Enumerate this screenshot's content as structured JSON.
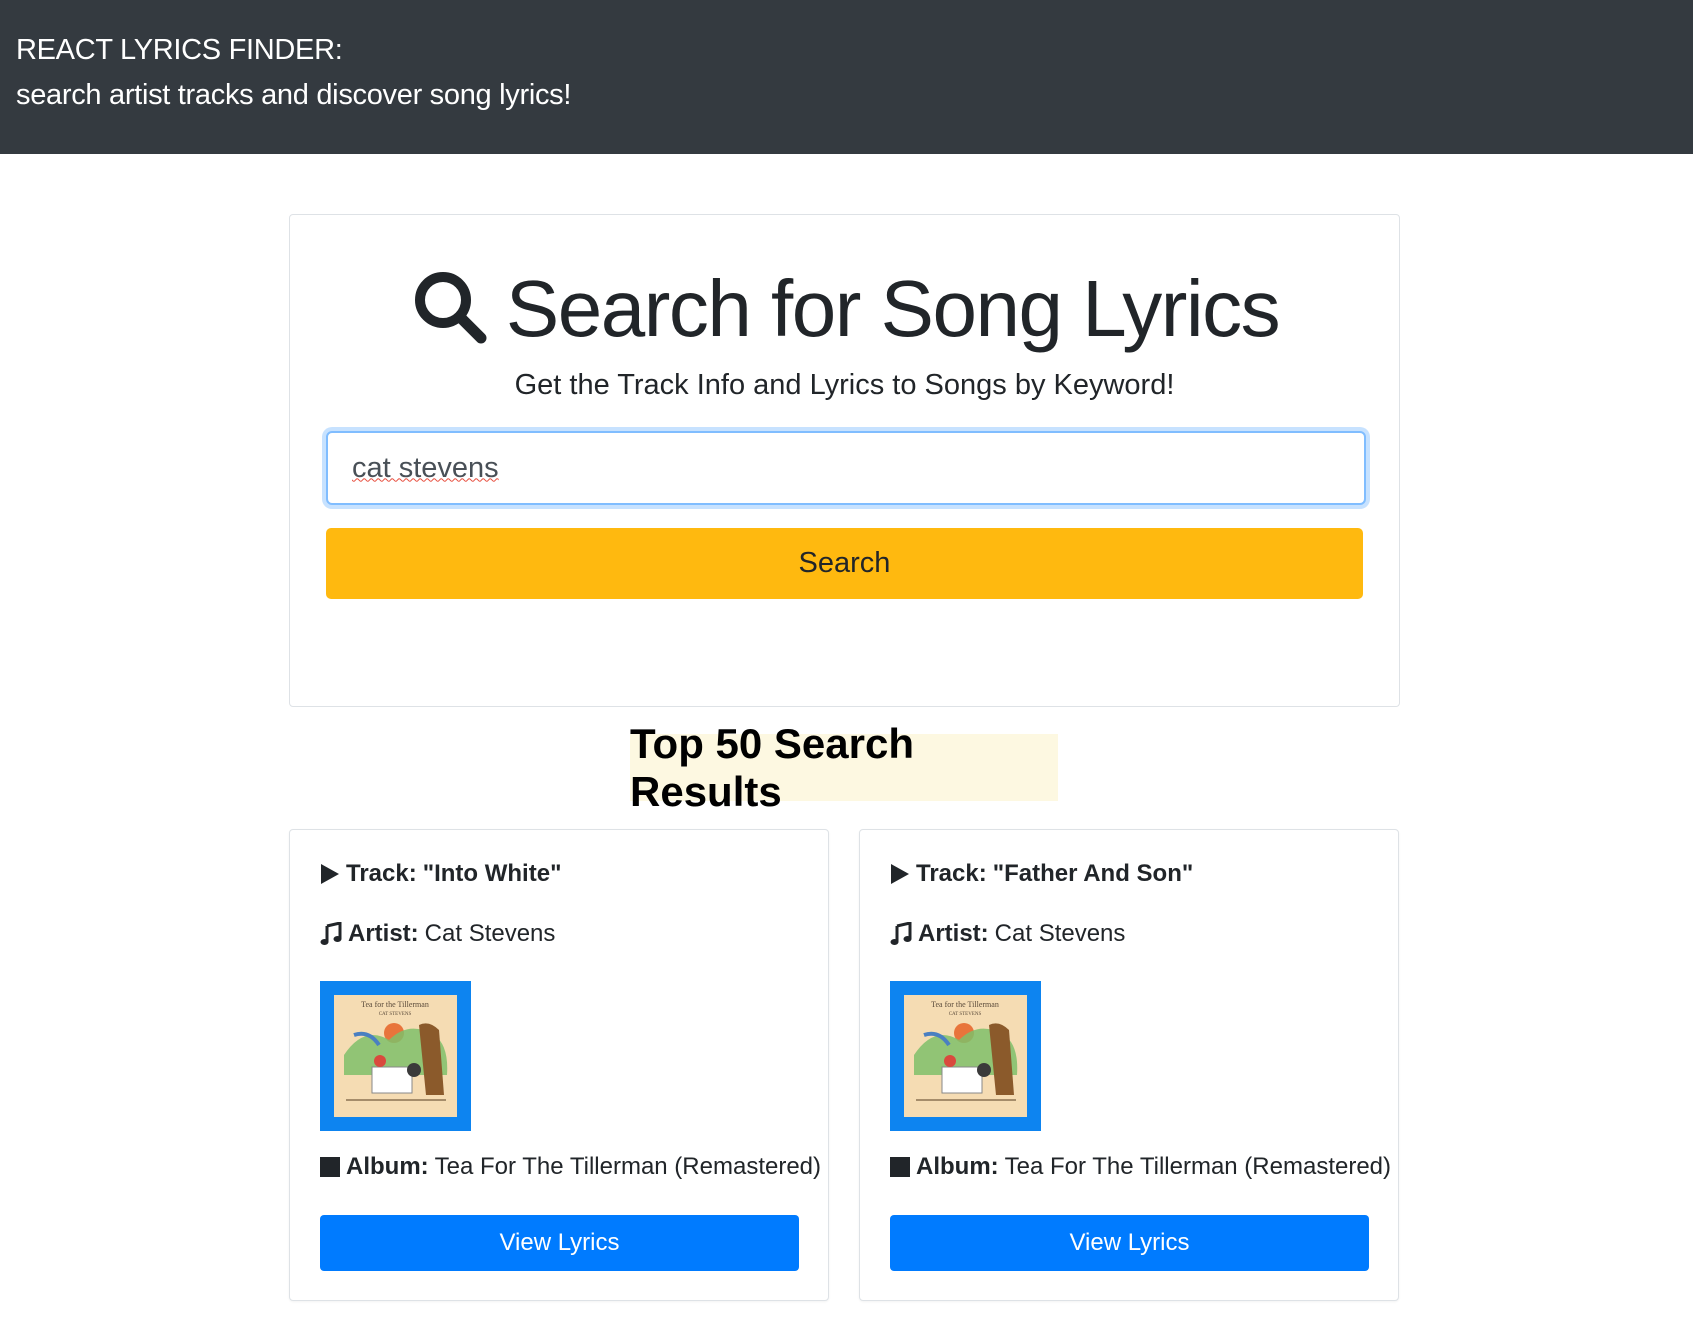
{
  "navbar": {
    "title": "REACT LYRICS FINDER:",
    "subtitle": "search artist tracks and discover song lyrics!"
  },
  "search": {
    "title": "Search for Song Lyrics",
    "subtitle": "Get the Track Info and Lyrics to Songs by Keyword!",
    "input_value": "cat stevens",
    "button_label": "Search",
    "icon": "search-icon"
  },
  "results": {
    "heading": "Top 50 Search Results",
    "tracks": [
      {
        "track_label": "Track:",
        "track_name": "\"Into White\"",
        "artist_label": "Artist:",
        "artist_name": "Cat Stevens",
        "album_label": "Album:",
        "album_name": "Tea For The Tillerman (Remastered)",
        "cover_title": "Tea for the Tillerman",
        "cover_artist": "CAT STEVENS",
        "button_label": "View Lyrics"
      },
      {
        "track_label": "Track:",
        "track_name": "\"Father And Son\"",
        "artist_label": "Artist:",
        "artist_name": "Cat Stevens",
        "album_label": "Album:",
        "album_name": "Tea For The Tillerman (Remastered)",
        "cover_title": "Tea for the Tillerman",
        "cover_artist": "CAT STEVENS",
        "button_label": "View Lyrics"
      }
    ]
  },
  "colors": {
    "navbar_bg": "#343a40",
    "search_button": "#ffb90f",
    "view_lyrics_button": "#007bff",
    "album_border": "#0d84f0",
    "results_heading_bg": "#fdf8e1"
  }
}
